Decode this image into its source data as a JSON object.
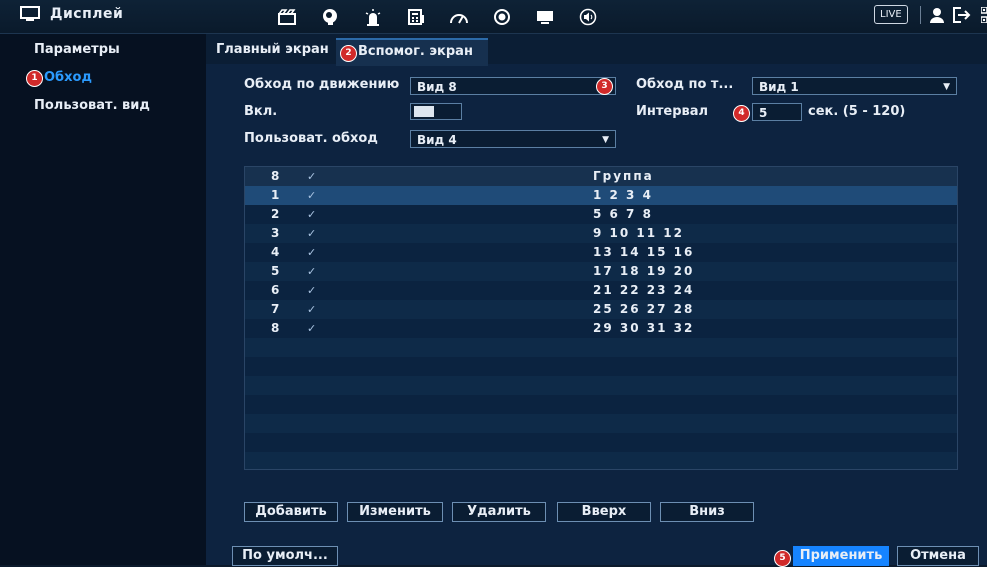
{
  "header": {
    "title": "Дисплей",
    "toolbar_icons": [
      "clapperboard-icon",
      "brain-icon",
      "alarm-light-icon",
      "calculator-icon",
      "gauge-icon",
      "record-icon",
      "monitor-icon",
      "speaker-icon"
    ],
    "live_label": "LIVE"
  },
  "sidebar": {
    "items": [
      {
        "label": "Параметры"
      },
      {
        "label": "Обход",
        "badge": "1"
      },
      {
        "label": "Пользоват. вид"
      }
    ]
  },
  "tabs": [
    {
      "label": "Главный экран"
    },
    {
      "label": "Вспомог. экран",
      "badge": "2"
    }
  ],
  "form": {
    "motion_tour_label": "Обход по движению",
    "motion_tour_value": "Вид 8",
    "motion_tour_badge": "3",
    "tour_by_label": "Обход по т...",
    "tour_by_value": "Вид 1",
    "enable_label": "Вкл.",
    "interval_label": "Интервал",
    "interval_badge": "4",
    "interval_value": "5",
    "interval_unit": "сек.  (5 - 120)",
    "custom_tour_label": "Пользоват. обход",
    "custom_tour_value": "Вид 4"
  },
  "table": {
    "header": {
      "num": "8",
      "check": "✓",
      "group": "Группа"
    },
    "rows": [
      {
        "num": "1",
        "check": "✓",
        "group": "1 2 3 4"
      },
      {
        "num": "2",
        "check": "✓",
        "group": "5 6 7 8"
      },
      {
        "num": "3",
        "check": "✓",
        "group": "9 10 11 12"
      },
      {
        "num": "4",
        "check": "✓",
        "group": "13 14 15 16"
      },
      {
        "num": "5",
        "check": "✓",
        "group": "17 18 19 20"
      },
      {
        "num": "6",
        "check": "✓",
        "group": "21 22 23 24"
      },
      {
        "num": "7",
        "check": "✓",
        "group": "25 26 27 28"
      },
      {
        "num": "8",
        "check": "✓",
        "group": "29 30 31 32"
      }
    ]
  },
  "buttons": {
    "add": "Добавить",
    "edit": "Изменить",
    "delete": "Удалить",
    "up": "Вверх",
    "down": "Вниз",
    "default": "По умолч...",
    "apply": "Применить",
    "apply_badge": "5",
    "cancel": "Отмена"
  },
  "colors": {
    "accent": "#1684ff",
    "badge": "#d12a2a",
    "selected_row": "#1f4b78"
  }
}
